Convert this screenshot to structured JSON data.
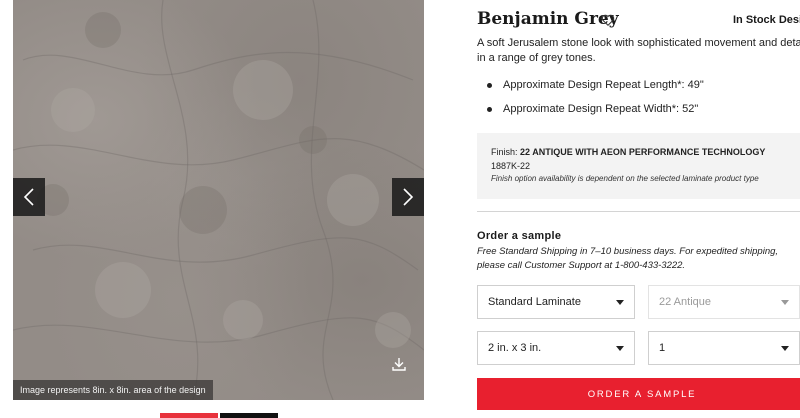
{
  "gallery": {
    "caption": "Image represents 8in. x 8in. area of the design",
    "prev_icon": "chevron-left-icon",
    "next_icon": "chevron-right-icon",
    "download_icon": "download-icon"
  },
  "product": {
    "title": "Benjamin Grey",
    "stock_status": "In Stock Desig",
    "description": "A soft Jerusalem stone look with sophisticated movement and detail in a range of grey tones.",
    "specs": [
      "Approximate Design Repeat Length*: 49\"",
      "Approximate Design Repeat Width*: 52\""
    ]
  },
  "finish": {
    "label": "Finish:",
    "value": "22 ANTIQUE  WITH AEON PERFORMANCE TECHNOLOGY",
    "code": "1887K-22",
    "note": "Finish option availability is dependent on the selected laminate product type"
  },
  "sample": {
    "heading": "Order a sample",
    "shipping_note": "Free Standard Shipping in 7–10 business days. For expedited shipping, please call Customer Support at 1-800-433-3222.",
    "product_type": "Standard Laminate",
    "finish_select": "22 Antique",
    "size": "2 in. x 3 in.",
    "quantity": "1",
    "order_button": "ORDER A SAMPLE"
  },
  "colors": {
    "accent": "#e8202f",
    "arrow_bg": "#191919",
    "stone": "#938c87"
  }
}
